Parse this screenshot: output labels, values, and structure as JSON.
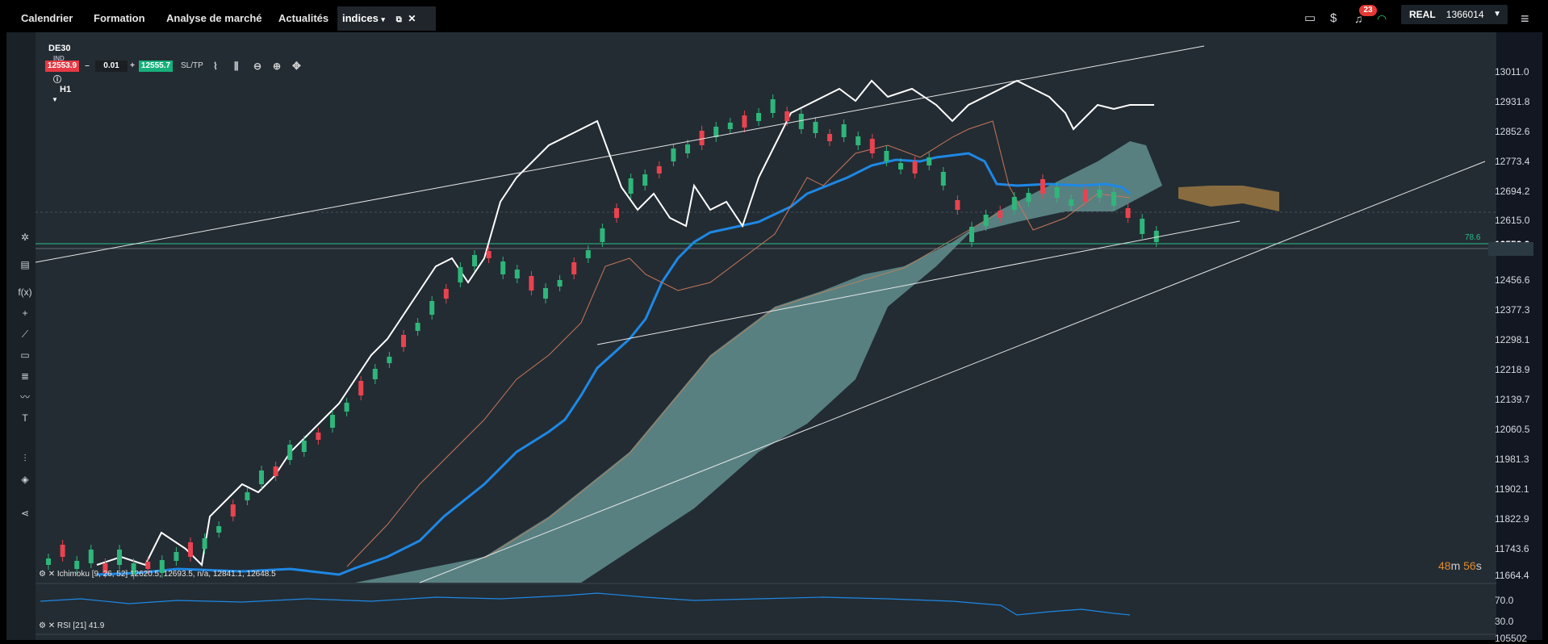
{
  "topnav": {
    "tabs": [
      "Calendrier",
      "Formation",
      "Analyse de marché",
      "Actualités"
    ],
    "active_tab": "indices",
    "notifications": "23",
    "account_mode": "REAL",
    "account_number": "1366014"
  },
  "instrument": {
    "symbol": "DE30",
    "type": "IND",
    "timeframe": "H1",
    "bid": "12553.9",
    "ask": "12555.7",
    "volume": "0.01",
    "sltp": "SL/TP",
    "minus": "–",
    "plus": "+"
  },
  "price_axis": [
    "13011.0",
    "12931.8",
    "12852.6",
    "12773.4",
    "12694.2",
    "12615.0",
    "12553.9",
    "12456.6",
    "12377.3",
    "12298.1",
    "12218.9",
    "12139.7",
    "12060.5",
    "11981.3",
    "11902.1",
    "11822.9",
    "11743.6",
    "11664.4"
  ],
  "fib_level": "78.6",
  "countdown": {
    "minutes": "48",
    "m": "m",
    "seconds": "56",
    "s": "s"
  },
  "indicators": {
    "ichimoku": "Ichimoku [9, 26, 52] 12620.5, 12693.5, n/a, 12841.1, 12648.5",
    "rsi": "RSI [21] 41.9",
    "rsi_levels": [
      "70.0",
      "30.0"
    ],
    "bottom_value": "105502"
  },
  "colors": {
    "bull": "#2fb67a",
    "bear": "#e8434f",
    "kijun": "#1e88e5",
    "cloud": "#6b9c9c",
    "cloud_bear": "#9a7842"
  },
  "chart_data": {
    "type": "candlestick",
    "symbol": "DE30",
    "timeframe": "H1",
    "y_range": [
      11664.4,
      13011.0
    ],
    "last_price": 12553.9
  }
}
